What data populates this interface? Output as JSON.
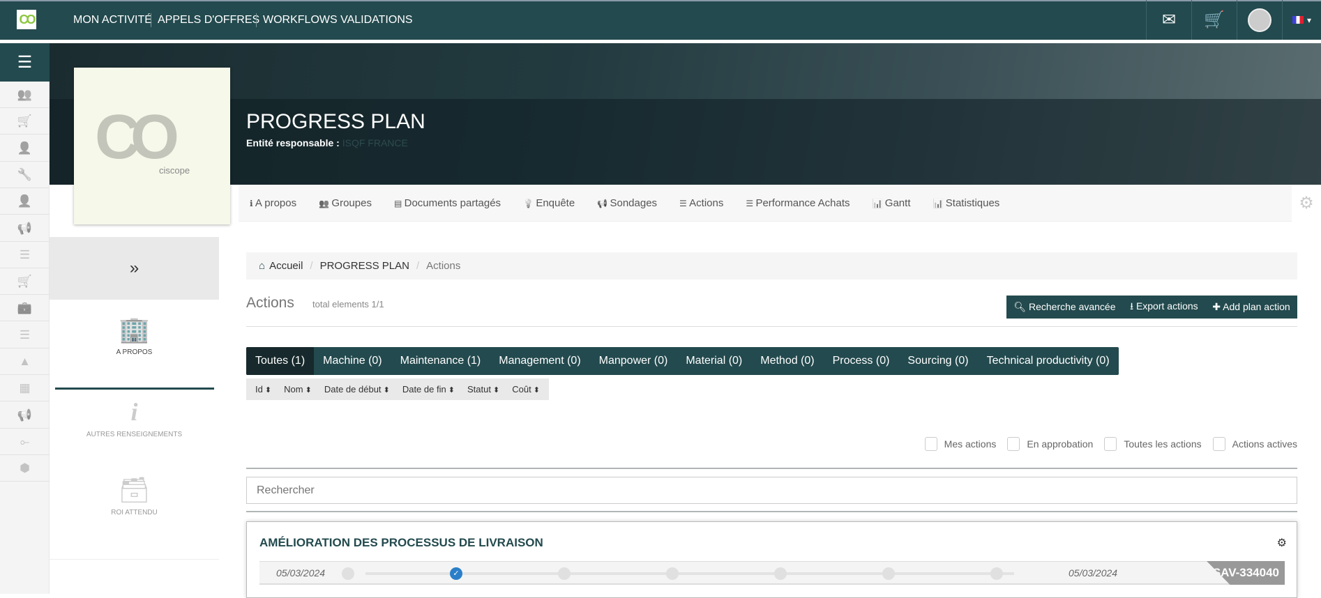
{
  "topbar": {
    "logo_text": "CO",
    "nav": [
      "MON ACTIVITÉ",
      "APPELS D'OFFRES",
      "WORKFLOWS VALIDATIONS"
    ],
    "icons": [
      "envelope-icon",
      "cart-icon",
      "avatar",
      "flag-fr-icon"
    ]
  },
  "sidebar": {
    "icons": [
      "users-icon",
      "cart-plus-icon",
      "user-icon",
      "wrench-icon",
      "user-icon",
      "bullhorn-icon",
      "list-icon",
      "cart-plus-icon",
      "briefcase-icon",
      "list-icon",
      "cone-icon",
      "calculator-icon",
      "bullhorn-icon",
      "nodes-icon",
      "cubes-icon"
    ]
  },
  "header": {
    "logo_text": "ciscope",
    "title": "PROGRESS PLAN",
    "entity_label": "Entité responsable",
    "entity_value": "ISQF FRANCE"
  },
  "tabs": [
    "A propos",
    "Groupes",
    "Documents partagés",
    "Enquête",
    "Sondages",
    "Actions",
    "Performance Achats",
    "Gantt",
    "Statistiques"
  ],
  "tab_icons": [
    "ℹ",
    "👥",
    "▤",
    "💡",
    "📢",
    "☰",
    "☰",
    "📊",
    "📊"
  ],
  "left_panel": {
    "collapse": "»",
    "items": [
      "A PROPOS",
      "AUTRES RENSEIGNEMENTS",
      "ROI ATTENDU"
    ]
  },
  "breadcrumb": [
    "Accueil",
    "PROGRESS PLAN",
    "Actions"
  ],
  "actions": {
    "title": "Actions",
    "count": "total elements 1/1",
    "buttons": [
      "Recherche avancée",
      "Export actions",
      "Add plan action"
    ]
  },
  "categories": [
    "Toutes (1)",
    "Machine (0)",
    "Maintenance (1)",
    "Management (0)",
    "Manpower (0)",
    "Material (0)",
    "Method (0)",
    "Process (0)",
    "Sourcing (0)",
    "Technical productivity (0)"
  ],
  "columns": [
    "Id",
    "Nom",
    "Date de début",
    "Date de fin",
    "Statut",
    "Coût"
  ],
  "filters": [
    "Mes actions",
    "En approbation",
    "Toutes les actions",
    "Actions actives"
  ],
  "search": {
    "placeholder": "Rechercher"
  },
  "card": {
    "title": "AMÉLIORATION DES PROCESSUS DE LIVRAISON",
    "start": "05/03/2024",
    "end": "05/03/2024",
    "code": "SAV-334040",
    "steps": 7,
    "current_step": 2
  },
  "colors": {
    "primary": "#234a4e",
    "step_active": "#2b7fc8"
  }
}
